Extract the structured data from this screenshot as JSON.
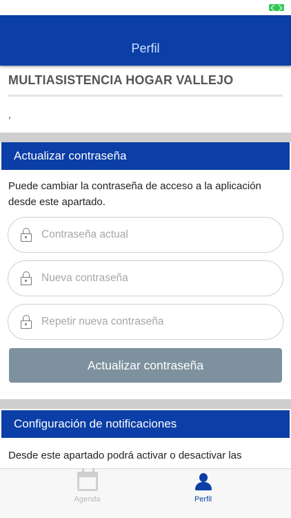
{
  "header": {
    "title": "Perfil"
  },
  "profile": {
    "company_name": "MULTIASISTENCIA HOGAR VALLEJO",
    "subline": ","
  },
  "password_section": {
    "title": "Actualizar contraseña",
    "description": "Puede cambiar la contraseña de acceso a la aplicación desde este apartado.",
    "fields": [
      {
        "placeholder": "Contraseña actual",
        "value": "",
        "icon": "lock-icon"
      },
      {
        "placeholder": "Nueva contraseña",
        "value": "",
        "icon": "lock-icon"
      },
      {
        "placeholder": "Repetir nueva contraseña",
        "value": "",
        "icon": "lock-icon"
      }
    ],
    "button_label": "Actualizar contraseña"
  },
  "notifications_section": {
    "title": "Configuración de notificaciones",
    "description": "Desde este apartado podrá activar o desactivar las"
  },
  "tabbar": {
    "tabs": [
      {
        "label": "Agenda",
        "icon": "calendar-icon",
        "active": false
      },
      {
        "label": "Perfil",
        "icon": "person-icon",
        "active": true
      }
    ]
  },
  "colors": {
    "primary": "#0b3ea6",
    "button_disabled": "#7d919e",
    "separator": "#cfcfcf"
  }
}
